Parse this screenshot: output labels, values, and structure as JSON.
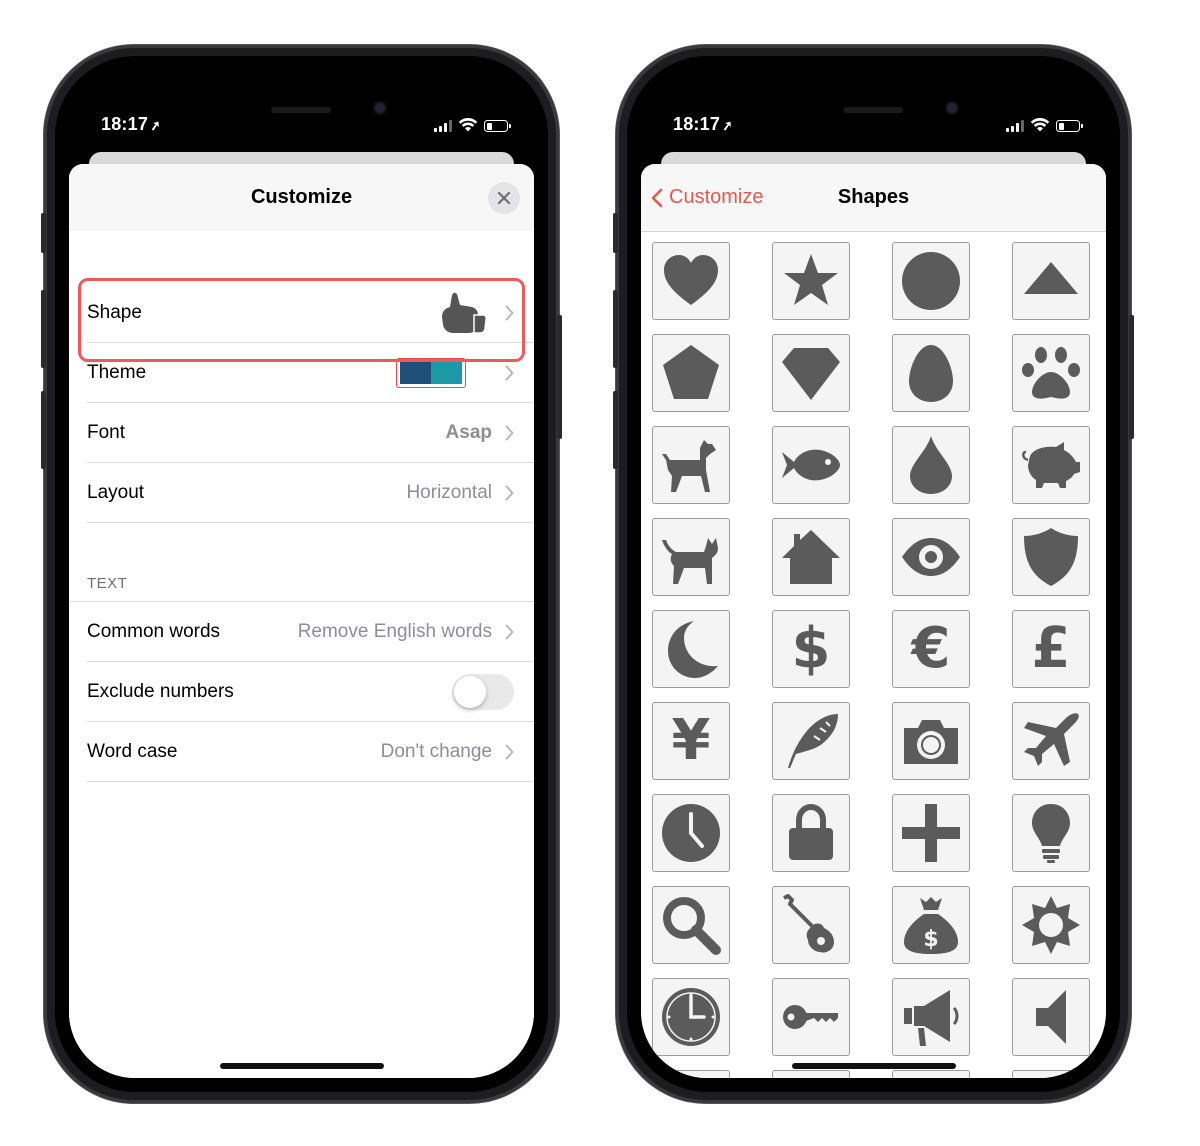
{
  "status_bar": {
    "time": "18:17",
    "location_glyph": "➤"
  },
  "left_screen": {
    "title": "Customize",
    "rows": {
      "shape": {
        "label": "Shape",
        "icon": "thumbs-up-icon"
      },
      "theme": {
        "label": "Theme",
        "colors": [
          "#1f4e79",
          "#1b9aa6"
        ]
      },
      "font": {
        "label": "Font",
        "value": "Asap"
      },
      "layout": {
        "label": "Layout",
        "value": "Horizontal"
      }
    },
    "text_section": {
      "header": "TEXT",
      "common_words": {
        "label": "Common words",
        "value": "Remove English words"
      },
      "exclude_numbers": {
        "label": "Exclude numbers",
        "on": false
      },
      "word_case": {
        "label": "Word case",
        "value": "Don't change"
      }
    }
  },
  "right_screen": {
    "back_label": "Customize",
    "title": "Shapes",
    "shapes": [
      "heart-icon",
      "star-icon",
      "circle-icon",
      "triangle-icon",
      "pentagon-icon",
      "diamond-icon",
      "egg-icon",
      "paw-icon",
      "dog-icon",
      "fish-icon",
      "drop-icon",
      "pig-icon",
      "cat-icon",
      "house-icon",
      "eye-icon",
      "shield-icon",
      "moon-icon",
      "dollar-icon",
      "euro-icon",
      "pound-icon",
      "yen-icon",
      "feather-icon",
      "camera-icon",
      "airplane-icon",
      "clock-icon",
      "lock-icon",
      "plus-icon",
      "lightbulb-icon",
      "magnifier-icon",
      "guitar-icon",
      "money-bag-icon",
      "sun-icon",
      "wall-clock-icon",
      "key-icon",
      "megaphone-icon",
      "speaker-icon"
    ],
    "glyphs": {
      "dollar": "$",
      "euro": "€",
      "pound": "£",
      "yen": "¥"
    }
  },
  "colors": {
    "accent": "#e05a52",
    "icon_fill": "#5b5b5b",
    "highlight": "#ec5b5b"
  }
}
